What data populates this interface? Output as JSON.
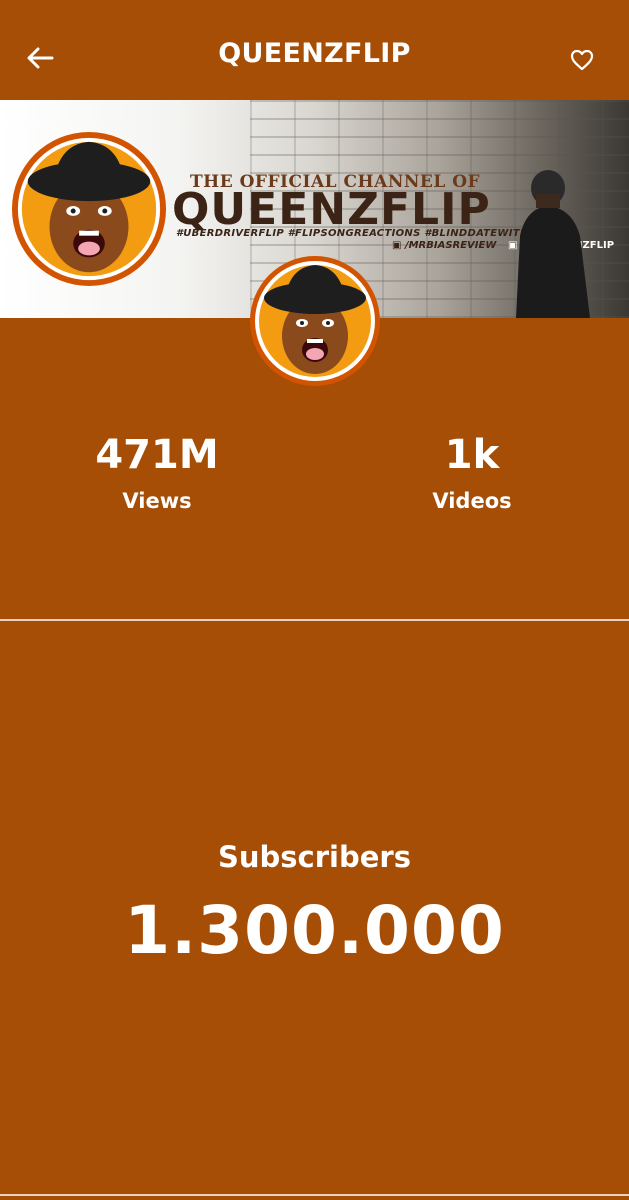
{
  "header": {
    "title": "QUEENZFLIP",
    "back_icon": "arrow-left-icon",
    "favorite_icon": "heart-outline-icon"
  },
  "banner": {
    "subtitle": "THE OFFICIAL CHANNEL OF",
    "name": "QUEENZFLIP",
    "hashtags": "#UBERDRIVERFLIP  #FLIPSONGREACTIONS  #BLINDDATEWITHFLIP",
    "facebook": "/MRBIASREVIEW",
    "social_handle": "@QUEENZFLIP"
  },
  "stats": {
    "views_value": "471M",
    "views_label": "Views",
    "videos_value": "1k",
    "videos_label": "Videos"
  },
  "subscribers": {
    "label": "Subscribers",
    "value": "1.300.000"
  },
  "colors": {
    "background": "#a64d06",
    "text": "#ffffff",
    "logo_orange": "#f39c12",
    "logo_ring": "#d35400"
  }
}
